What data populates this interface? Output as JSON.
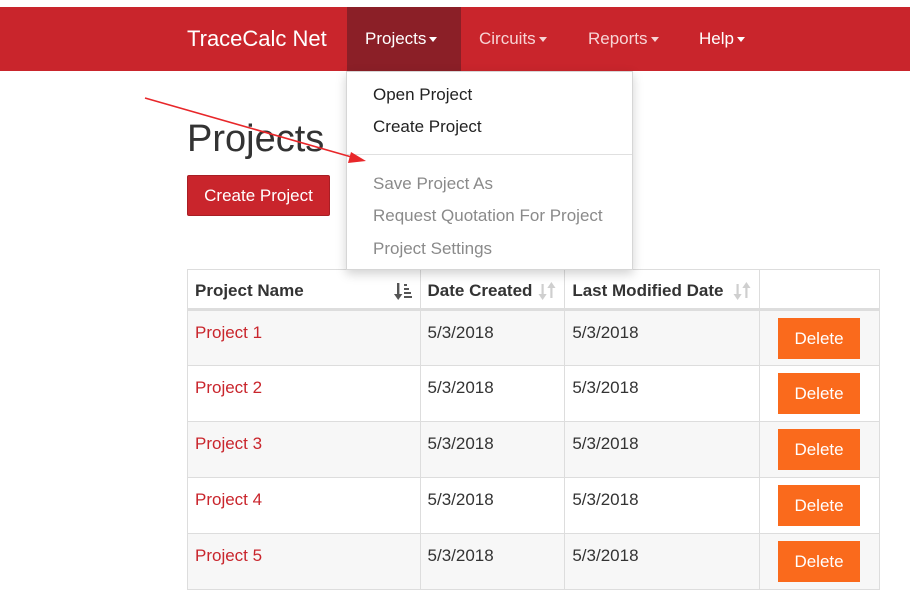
{
  "navbar": {
    "brand": "TraceCalc Net",
    "items": [
      {
        "label": "Projects",
        "active": true
      },
      {
        "label": "Circuits"
      },
      {
        "label": "Reports"
      },
      {
        "label": "Help"
      }
    ]
  },
  "dropdown": {
    "items": [
      {
        "label": "Open Project",
        "enabled": true
      },
      {
        "label": "Create Project",
        "enabled": true
      },
      {
        "label": "Save Project As",
        "enabled": false
      },
      {
        "label": "Request Quotation For Project",
        "enabled": false
      },
      {
        "label": "Project Settings",
        "enabled": false
      }
    ]
  },
  "page": {
    "title": "Projects",
    "create_button": "Create Project"
  },
  "table": {
    "columns": [
      "Project Name",
      "Date Created",
      "Last Modified Date",
      ""
    ],
    "rows": [
      {
        "name": "Project 1",
        "created": "5/3/2018",
        "modified": "5/3/2018",
        "action": "Delete"
      },
      {
        "name": "Project 2",
        "created": "5/3/2018",
        "modified": "5/3/2018",
        "action": "Delete"
      },
      {
        "name": "Project 3",
        "created": "5/3/2018",
        "modified": "5/3/2018",
        "action": "Delete"
      },
      {
        "name": "Project 4",
        "created": "5/3/2018",
        "modified": "5/3/2018",
        "action": "Delete"
      },
      {
        "name": "Project 5",
        "created": "5/3/2018",
        "modified": "5/3/2018",
        "action": "Delete"
      }
    ]
  },
  "colors": {
    "brand_red": "#c9252c",
    "active_nav": "#8b1f27",
    "delete_orange": "#fa6a1c",
    "annotation_arrow": "#e8272a"
  }
}
